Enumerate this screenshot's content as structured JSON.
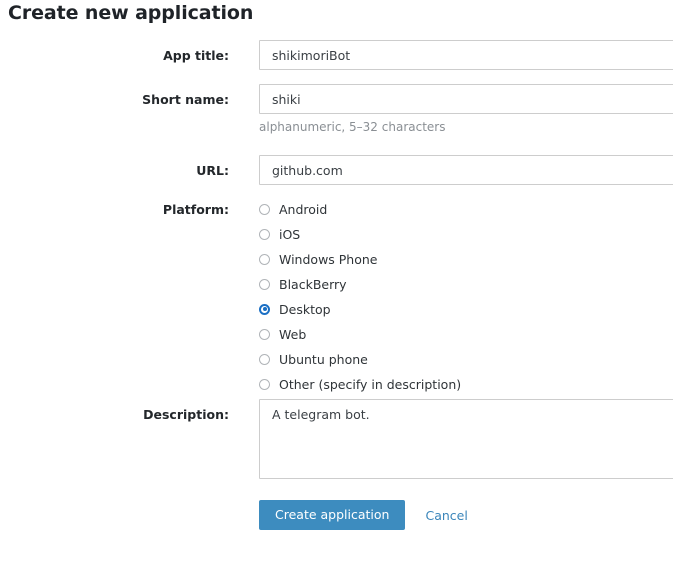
{
  "page": {
    "title": "Create new application"
  },
  "form": {
    "app_title": {
      "label": "App title:",
      "value": "shikimoriBot"
    },
    "short_name": {
      "label": "Short name:",
      "value": "shiki",
      "help": "alphanumeric, 5–32 characters"
    },
    "url": {
      "label": "URL:",
      "value": "github.com"
    },
    "platform": {
      "label": "Platform:",
      "selected": "Desktop",
      "options": [
        {
          "label": "Android",
          "selected": false
        },
        {
          "label": "iOS",
          "selected": false
        },
        {
          "label": "Windows Phone",
          "selected": false
        },
        {
          "label": "BlackBerry",
          "selected": false
        },
        {
          "label": "Desktop",
          "selected": true
        },
        {
          "label": "Web",
          "selected": false
        },
        {
          "label": "Ubuntu phone",
          "selected": false
        },
        {
          "label": "Other (specify in description)",
          "selected": false
        }
      ]
    },
    "description": {
      "label": "Description:",
      "value": "A telegram bot."
    },
    "actions": {
      "submit_label": "Create application",
      "cancel_label": "Cancel"
    }
  },
  "colors": {
    "primary_button": "#3d8cbf",
    "link": "#3a85ba",
    "radio_selected": "#1a6fc4",
    "input_border": "#cdcdcd",
    "help_text": "#8a8f94"
  }
}
